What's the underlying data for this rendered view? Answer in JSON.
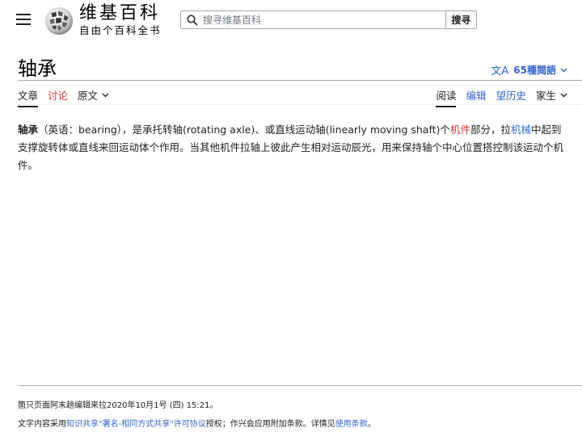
{
  "header": {
    "logo_title": "维基百科",
    "logo_tagline": "自由个百科全书",
    "search_placeholder": "搜寻维基百科",
    "search_button": "搜寻"
  },
  "page": {
    "title": "轴承",
    "languages_label": "65種閱語"
  },
  "tabs_left": [
    {
      "label": "文章"
    },
    {
      "label": "讨论"
    },
    {
      "label": "原文"
    }
  ],
  "tabs_right": [
    {
      "label": "阅读"
    },
    {
      "label": "编辑"
    },
    {
      "label": "望历史"
    },
    {
      "label": "家生"
    }
  ],
  "content": {
    "bold_term": "轴承",
    "part1": "（英语：bearing），是承托转轴(rotating axle)、或直线运动轴(linearly moving shaft)个",
    "link1": "机件",
    "part2": "部分，拉",
    "link2": "机械",
    "part3": "中起到支撑旋转体或直线来回运动体个作用。当其他机件拉轴上彼此产生相对运动辰光，用来保持轴个中心位置搭控制该运动个机件。"
  },
  "footer": {
    "last_edited": "箇只页面阿末趟编辑来拉2020年10月1号 (四) 15:21。",
    "license_prefix": "文字内容采用",
    "license_link": "知识共享\"署名-相同方式共享\"许可协议",
    "license_middle": "授权；作兴会应用附加条款。详情见",
    "terms_link": "使用条款",
    "license_suffix": "。"
  },
  "colors": {
    "link": "#3366cc",
    "new_link": "#d73333",
    "text": "#202122",
    "border": "#a2a9b1"
  },
  "icons": {
    "menu": "hamburger-menu-icon",
    "logo": "wikipedia-globe-icon",
    "search": "search-icon",
    "language": "translate-icon",
    "dropdown": "chevron-down-icon"
  }
}
